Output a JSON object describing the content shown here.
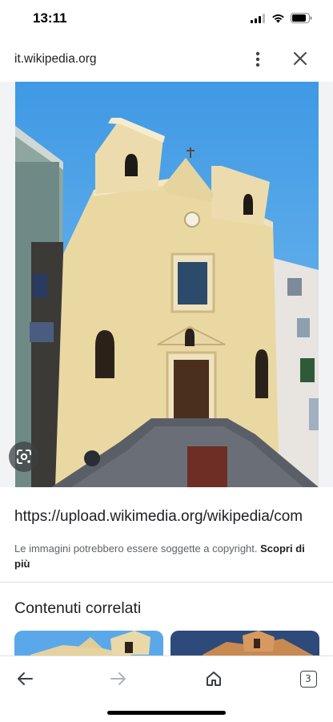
{
  "status_bar": {
    "time": "13:11"
  },
  "browser": {
    "url": "it.wikipedia.org"
  },
  "image_panel": {
    "image_url": "https://upload.wikimedia.org/wikipedia/com"
  },
  "notice": {
    "text": "Le immagini potrebbero essere soggette a copyright. ",
    "link": "Scopri di più"
  },
  "related": {
    "title": "Contenuti correlati"
  },
  "toolbar": {
    "tab_count": "3"
  },
  "icons": [
    "signal-icon",
    "wifi-icon",
    "battery-icon",
    "more-vert-icon",
    "close-icon",
    "lens-icon",
    "back-arrow-icon",
    "forward-arrow-icon",
    "home-icon",
    "tabs-icon"
  ],
  "colors": {
    "sky": "#3c9ae6",
    "facade": "#e9d8a6",
    "text": "#202124",
    "secondary": "#5f6368"
  }
}
